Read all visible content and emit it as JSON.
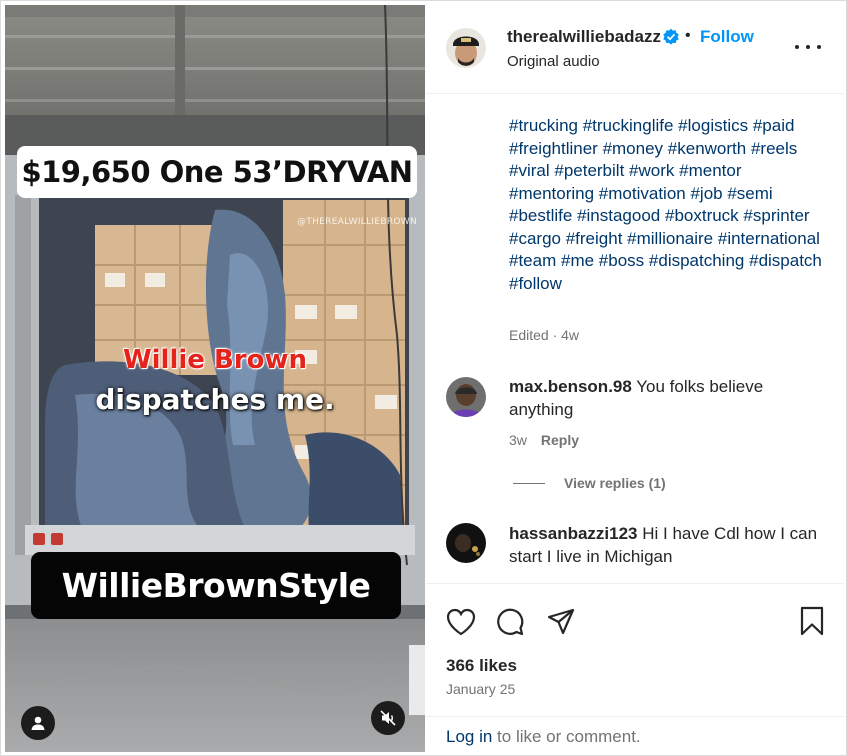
{
  "media": {
    "top_caption": "$19,650 One 53’DRYVAN",
    "watermark": "@THEREALWILLIEBROWN",
    "overlay_red": "Willie Brown",
    "overlay_white": "dispatches me.",
    "bottom_caption": "WillieBrownStyle"
  },
  "post": {
    "username": "therealwilliebadazz",
    "separator": "•",
    "follow_label": "Follow",
    "audio": "Original audio",
    "hashtags": [
      "#trucking",
      "#truckinglife",
      "#logistics",
      "#paid",
      "#freightliner",
      "#money",
      "#kenworth",
      "#reels",
      "#viral",
      "#peterbilt",
      "#work",
      "#mentor",
      "#mentoring",
      "#motivation",
      "#job",
      "#semi",
      "#bestlife",
      "#instagood",
      "#boxtruck",
      "#sprinter",
      "#cargo",
      "#freight",
      "#millionaire",
      "#international",
      "#team",
      "#me",
      "#boss",
      "#dispatching",
      "#dispatch",
      "#follow"
    ],
    "edited": "Edited · 4w"
  },
  "comments": [
    {
      "username": "max.benson.98",
      "text": "You folks believe anything",
      "age": "3w",
      "reply_label": "Reply",
      "view_replies": "View replies (1)"
    },
    {
      "username": "hassanbazzi123",
      "text": "Hi I have Cdl how I can start I live in Michigan"
    }
  ],
  "footer": {
    "likes": "366 likes",
    "date": "January 25",
    "login_link": "Log in",
    "login_rest": " to like or comment."
  },
  "colors": {
    "accent": "#0095f6",
    "hashtag": "#00376b",
    "muted": "#737373",
    "overlay_red": "#e5231b"
  },
  "icons": [
    "verified-badge-icon",
    "more-options-icon",
    "heart-icon",
    "comment-icon",
    "share-icon",
    "bookmark-icon",
    "user-tag-icon",
    "mute-icon"
  ]
}
